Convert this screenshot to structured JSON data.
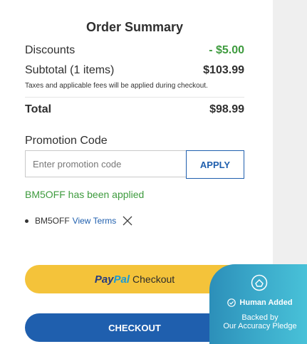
{
  "summary": {
    "title": "Order Summary",
    "discounts_label": "Discounts",
    "discounts_value": "- $5.00",
    "subtotal_label": "Subtotal (1 items)",
    "subtotal_value": "$103.99",
    "tax_note": "Taxes and applicable fees will be applied during checkout.",
    "total_label": "Total",
    "total_value": "$98.99"
  },
  "promo": {
    "label": "Promotion Code",
    "placeholder": "Enter promotion code",
    "apply_label": "APPLY",
    "applied_message": "BM5OFF has been applied",
    "coupon_code": "BM5OFF",
    "view_terms": "View Terms"
  },
  "buttons": {
    "paypal_word1": "Pay",
    "paypal_word2": "Pal",
    "paypal_label": "Checkout",
    "checkout_label": "CHECKOUT"
  },
  "badge": {
    "added": "Human Added",
    "backed": "Backed by",
    "pledge": "Our Accuracy Pledge"
  },
  "colors": {
    "accent_blue": "#1f5fae",
    "success_green": "#3e9b3e",
    "paypal_yellow": "#f4c33a"
  },
  "icons": [
    "remove-icon",
    "badge-logo-icon",
    "check-circle-icon"
  ]
}
